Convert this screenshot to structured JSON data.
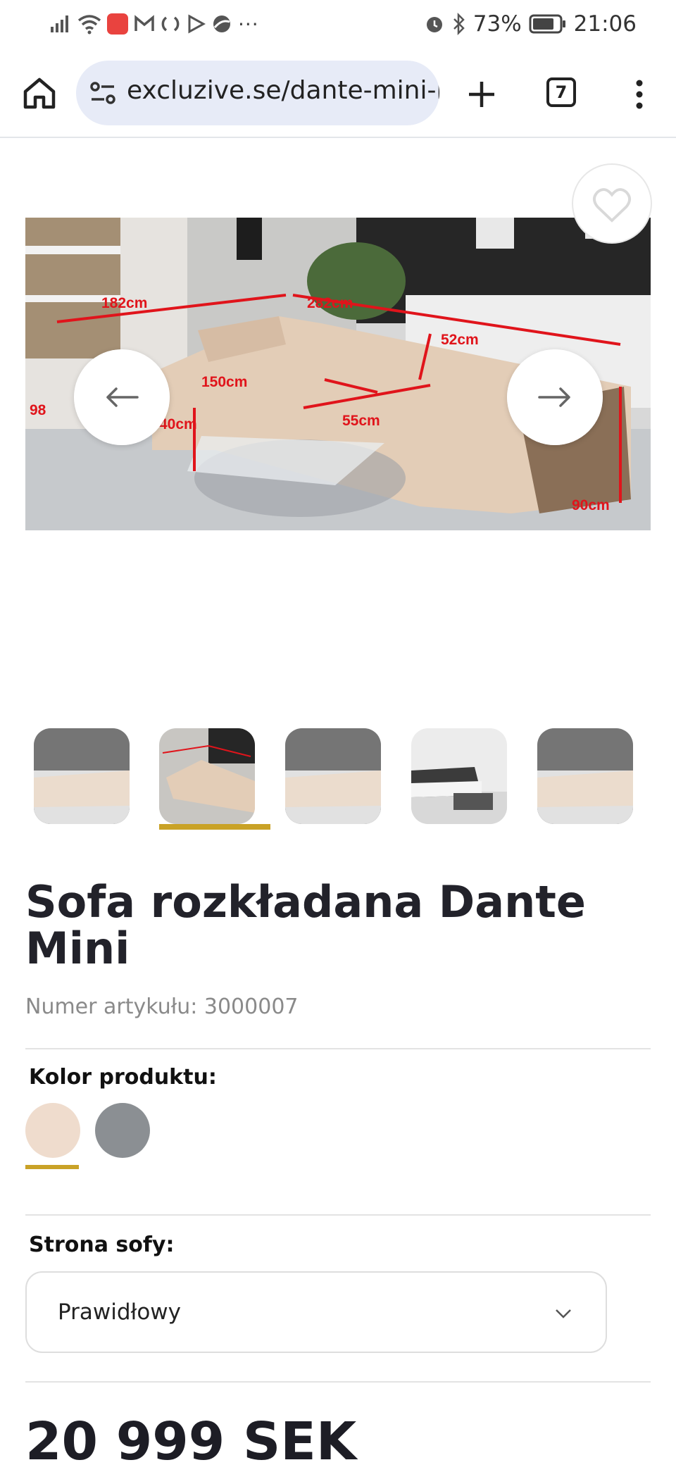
{
  "status_bar": {
    "battery": "73%",
    "time": "21:06",
    "more": "···",
    "icons": [
      "signal-icon",
      "wifi-icon",
      "huawei-app-icon",
      "gmail-icon",
      "sync-icon",
      "play-icon",
      "vpn-icon",
      "alarm-icon",
      "bluetooth-icon",
      "battery-icon"
    ]
  },
  "browser": {
    "url": "excluzive.se/dante-mini-b",
    "tab_count": "7"
  },
  "hero": {
    "dimension_labels": [
      "182cm",
      "282cm",
      "52cm",
      "150cm",
      "98",
      "40cm",
      "55cm",
      "90cm"
    ]
  },
  "thumbnails": {
    "count": 5,
    "selected_index": 1
  },
  "product": {
    "title": "Sofa rozkładana Dante Mini",
    "article_number": "Numer artykułu: 3000007",
    "color_label": "Kolor produktu:",
    "colors": [
      "#efdccd",
      "#8b8f93"
    ],
    "selected_color_index": 0,
    "side_label": "Strona sofy:",
    "side_value": "Prawidłowy",
    "price": "20 999  SEK"
  },
  "colors": {
    "accent": "#c9a227",
    "dimension_red": "#e0141b"
  }
}
